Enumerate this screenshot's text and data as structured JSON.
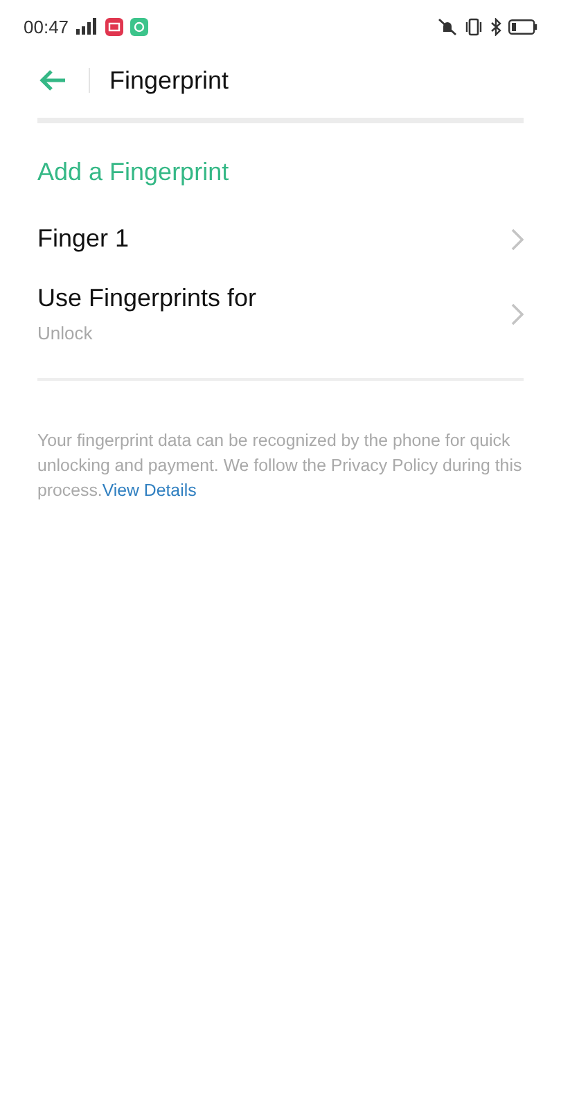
{
  "status_bar": {
    "time": "00:47"
  },
  "header": {
    "title": "Fingerprint"
  },
  "add_action": "Add a Fingerprint",
  "items": [
    {
      "title": "Finger 1"
    },
    {
      "title": "Use Fingerprints for",
      "subtitle": "Unlock"
    }
  ],
  "note": {
    "text": "Your fingerprint data can be recognized by the phone for quick unlocking and payment. We follow the Privacy Policy during this process.",
    "link": "View Details"
  }
}
